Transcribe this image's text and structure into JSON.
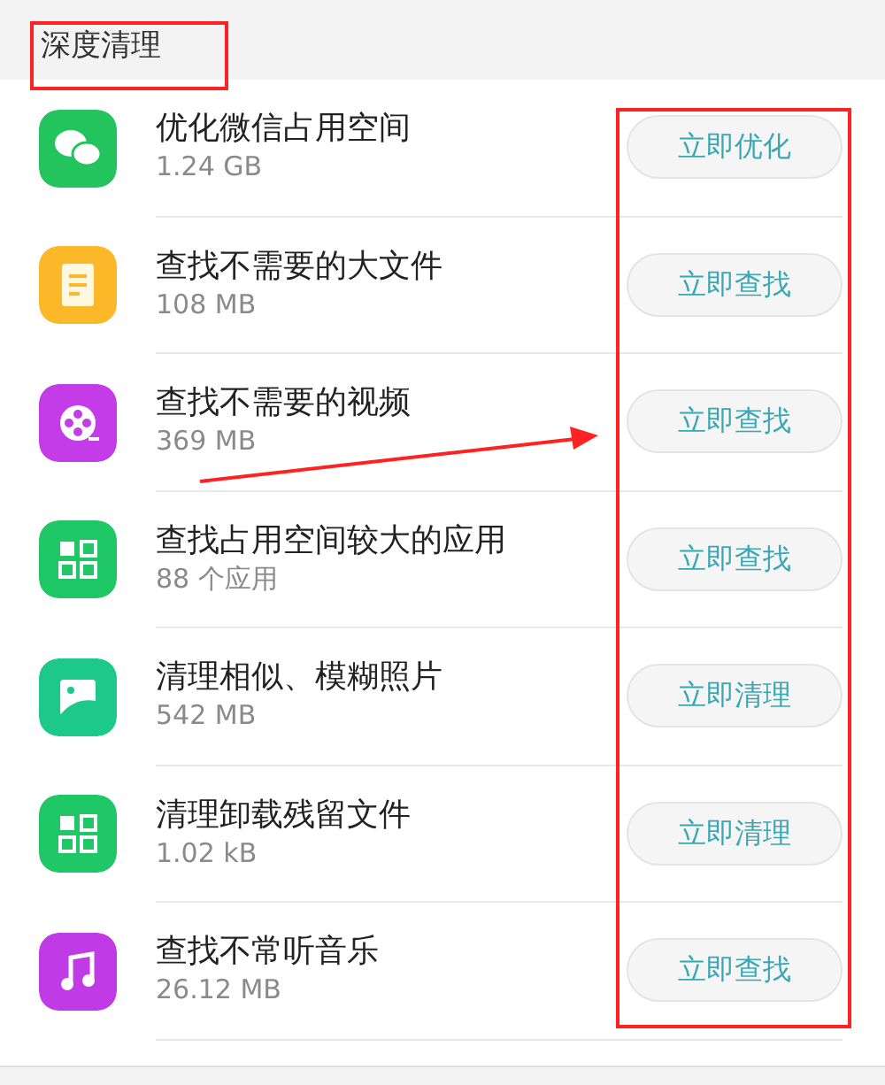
{
  "section": {
    "title": "深度清理"
  },
  "items": [
    {
      "kind": "chat",
      "color": "#23c45e",
      "title": "优化微信占用空间",
      "detail": "1.24 GB",
      "button": "立即优化"
    },
    {
      "kind": "document",
      "color": "#fbb929",
      "title": "查找不需要的大文件",
      "detail": "108 MB",
      "button": "立即查找"
    },
    {
      "kind": "film",
      "color": "#c43be8",
      "title": "查找不需要的视频",
      "detail": "369 MB",
      "button": "立即查找"
    },
    {
      "kind": "grid",
      "color": "#1fc766",
      "title": "查找占用空间较大的应用",
      "detail": "88 个应用",
      "button": "立即查找"
    },
    {
      "kind": "image",
      "color": "#1cc98a",
      "title": "清理相似、模糊照片",
      "detail": "542 MB",
      "button": "立即清理"
    },
    {
      "kind": "grid",
      "color": "#1fc766",
      "title": "清理卸载残留文件",
      "detail": "1.02 kB",
      "button": "立即清理"
    },
    {
      "kind": "music",
      "color": "#c03ae6",
      "title": "查找不常听音乐",
      "detail": "26.12 MB",
      "button": "立即查找"
    }
  ]
}
